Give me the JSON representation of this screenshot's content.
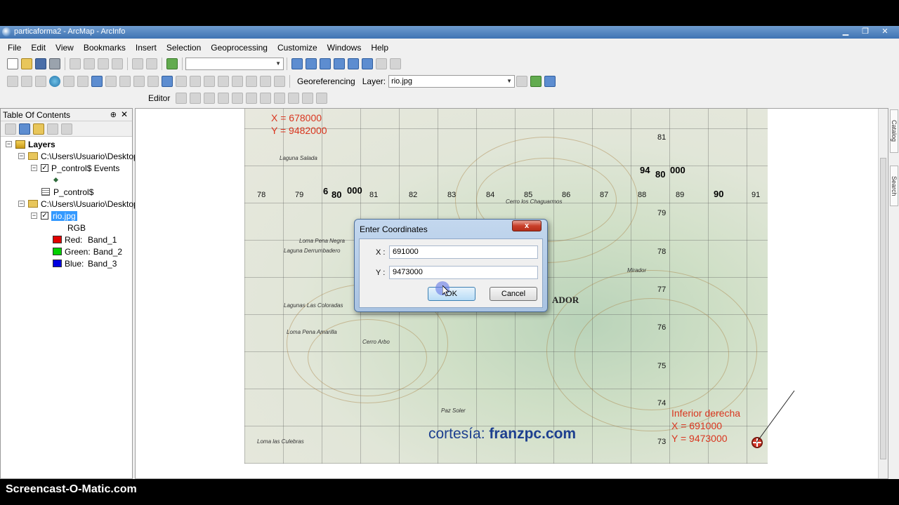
{
  "window": {
    "title": "particaforma2 - ArcMap - ArcInfo",
    "controls": [
      "▁",
      "❐",
      "✕"
    ]
  },
  "menubar": [
    "File",
    "Edit",
    "View",
    "Bookmarks",
    "Insert",
    "Selection",
    "Geoprocessing",
    "Customize",
    "Windows",
    "Help"
  ],
  "toolbar": {
    "georeferencing_label": "Georeferencing",
    "layer_label": "Layer:",
    "layer_value": "rio.jpg",
    "editor_label": "Editor"
  },
  "toc": {
    "title": "Table Of Contents",
    "pin": "⊕",
    "close": "✕",
    "layers_root": "Layers",
    "group1_path": "C:\\Users\\Usuario\\Desktop",
    "events_layer": "P_control$ Events",
    "table_layer": "P_control$",
    "group2_path": "C:\\Users\\Usuario\\Desktop",
    "raster_layer": "rio.jpg",
    "rgb_label": "RGB",
    "bands": [
      {
        "channel": "Red:",
        "band": "Band_1",
        "color": "#e00000"
      },
      {
        "channel": "Green:",
        "band": "Band_2",
        "color": "#00d000"
      },
      {
        "channel": "Blue:",
        "band": "Band_3",
        "color": "#0000e0"
      }
    ]
  },
  "map": {
    "top_note_x": "X = 678000",
    "top_note_y": "Y = 9482000",
    "top_row_numbers": [
      "78",
      "79",
      "81",
      "82",
      "83",
      "84",
      "85",
      "86",
      "87",
      "88",
      "89",
      "90",
      "91"
    ],
    "right_col_numbers": [
      "81",
      "79",
      "78",
      "77",
      "76",
      "75",
      "74",
      "73"
    ],
    "big_6": "6",
    "big_80": "80",
    "big_000": "000",
    "big_94": "94",
    "big_80b": "80",
    "big_000b": "000",
    "ador_text": "ADOR",
    "bottom_note_title": "Inferior derecha",
    "bottom_note_x": "X = 691000",
    "bottom_note_y": "Y = 9473000",
    "credit_prefix": "cortesía:",
    "credit_site": "franzpc.com",
    "places": [
      "Laguna Salada",
      "Laguna Derrumbadero",
      "Lagunas Las Coloradas",
      "Loma Pena Amarilla",
      "Cerro Arbo",
      "Loma Pena Negra",
      "Paz Soler",
      "Loma las Culebras",
      "Cerro los Chaguarmos",
      "Mirador"
    ]
  },
  "dialog": {
    "title": "Enter Coordinates",
    "close_label": "x",
    "x_label": "X :",
    "x_value": "691000",
    "y_label": "Y :",
    "y_value": "9473000",
    "ok_label": "OK",
    "cancel_label": "Cancel"
  },
  "side_tabs": [
    "Catalog",
    "Search"
  ],
  "watermark": "Screencast-O-Matic.com"
}
